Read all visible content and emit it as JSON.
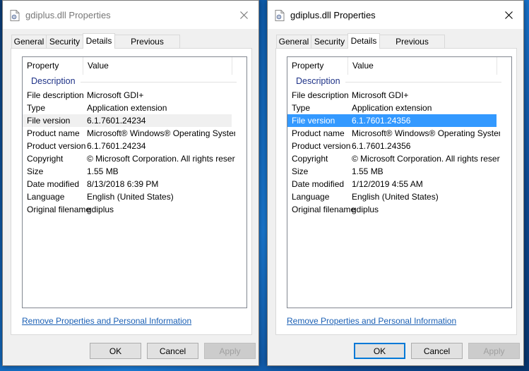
{
  "dialogs": [
    {
      "title": "gdiplus.dll Properties",
      "tabs": [
        "General",
        "Security",
        "Details",
        "Previous Versions"
      ],
      "active_tab": "Details",
      "columns": {
        "property": "Property",
        "value": "Value"
      },
      "group": "Description",
      "rows": [
        {
          "k": "File description",
          "v": "Microsoft GDI+"
        },
        {
          "k": "Type",
          "v": "Application extension"
        },
        {
          "k": "File version",
          "v": "6.1.7601.24234"
        },
        {
          "k": "Product name",
          "v": "Microsoft® Windows® Operating System"
        },
        {
          "k": "Product version",
          "v": "6.1.7601.24234"
        },
        {
          "k": "Copyright",
          "v": "© Microsoft Corporation. All rights reserv..."
        },
        {
          "k": "Size",
          "v": "1.55 MB"
        },
        {
          "k": "Date modified",
          "v": "8/13/2018 6:39 PM"
        },
        {
          "k": "Language",
          "v": "English (United States)"
        },
        {
          "k": "Original filename",
          "v": "gdiplus"
        }
      ],
      "remove_link": "Remove Properties and Personal Information",
      "buttons": {
        "ok": "OK",
        "cancel": "Cancel",
        "apply": "Apply"
      }
    },
    {
      "title": "gdiplus.dll Properties",
      "tabs": [
        "General",
        "Security",
        "Details",
        "Previous Versions"
      ],
      "active_tab": "Details",
      "columns": {
        "property": "Property",
        "value": "Value"
      },
      "group": "Description",
      "rows": [
        {
          "k": "File description",
          "v": "Microsoft GDI+"
        },
        {
          "k": "Type",
          "v": "Application extension"
        },
        {
          "k": "File version",
          "v": "6.1.7601.24356"
        },
        {
          "k": "Product name",
          "v": "Microsoft® Windows® Operating System"
        },
        {
          "k": "Product version",
          "v": "6.1.7601.24356"
        },
        {
          "k": "Copyright",
          "v": "© Microsoft Corporation. All rights reserv..."
        },
        {
          "k": "Size",
          "v": "1.55 MB"
        },
        {
          "k": "Date modified",
          "v": "1/12/2019 4:55 AM"
        },
        {
          "k": "Language",
          "v": "English (United States)"
        },
        {
          "k": "Original filename",
          "v": "gdiplus"
        }
      ],
      "remove_link": "Remove Properties and Personal Information",
      "buttons": {
        "ok": "OK",
        "cancel": "Cancel",
        "apply": "Apply"
      }
    }
  ],
  "colors": {
    "selection": "#3399ff",
    "link": "#1a5fb4",
    "group_title": "#1e3287",
    "default_button_border": "#0078d7"
  },
  "icons": {
    "file": "dll-file-icon",
    "close": "close-icon"
  }
}
